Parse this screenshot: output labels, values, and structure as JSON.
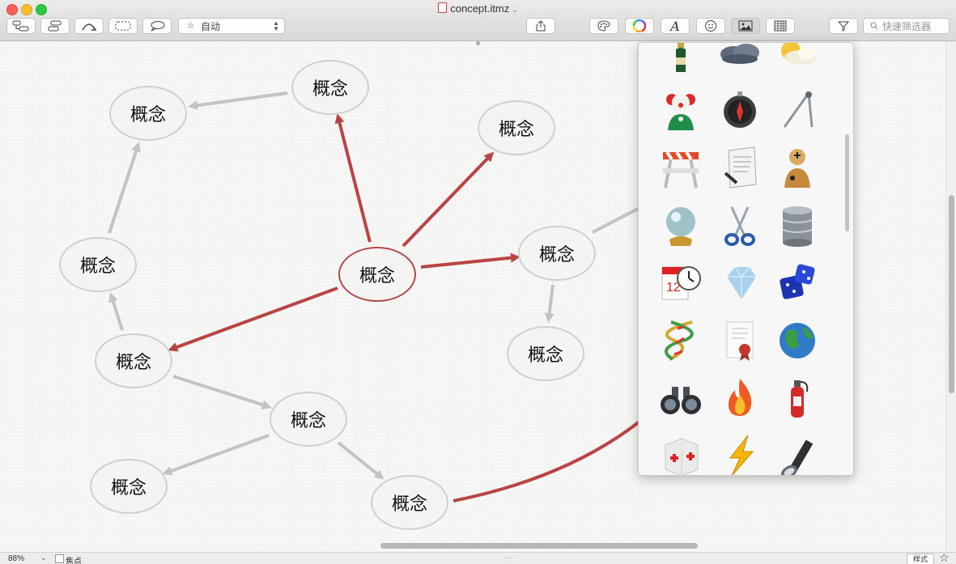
{
  "window": {
    "title": "concept.itmz",
    "title_menu_icon": "chevron-down-icon"
  },
  "toolbar": {
    "buttons": [
      {
        "name": "add-topic-button",
        "icon": "add-topic-icon"
      },
      {
        "name": "add-subtopic-button",
        "icon": "add-subtopic-icon"
      },
      {
        "name": "relationship-button",
        "icon": "relationship-arrow-icon"
      },
      {
        "name": "boundary-button",
        "icon": "boundary-icon"
      },
      {
        "name": "callout-button",
        "icon": "callout-icon"
      }
    ],
    "layout_select": {
      "icon": "star-icon",
      "value": "自动"
    },
    "share_icon": "share-icon",
    "style_buttons": [
      "palette-icon",
      "color-wheel-icon",
      "font-icon",
      "emoji-icon",
      "image-icon",
      "table-icon"
    ],
    "filter_icon": "filter-icon",
    "filter_placeholder": "快速筛选器"
  },
  "map": {
    "root": "概念",
    "nodes": [
      "概念",
      "概念",
      "概念",
      "概念",
      "概念",
      "概念",
      "概念",
      "概念",
      "概念",
      "概念",
      "概念",
      "概念"
    ],
    "colors": {
      "relationship": "#b84444",
      "link": "#c3c3c3",
      "node_border": "#cfcfcf"
    }
  },
  "image_panel": {
    "icons": [
      "champagne-icon",
      "cloud-icon",
      "sun-cloud-icon",
      "clown-icon",
      "compass-icon",
      "drawing-compass-icon",
      "barrier-icon",
      "contract-icon",
      "crash-dummy-icon",
      "crystal-ball-icon",
      "scissors-icon",
      "database-icon",
      "calendar-clock-icon",
      "diamond-icon",
      "dice-icon",
      "dna-icon",
      "certificate-icon",
      "globe-icon",
      "binoculars-icon",
      "fire-icon",
      "fire-extinguisher-icon",
      "first-aid-icon",
      "lightning-icon",
      "flashlight-icon"
    ]
  },
  "statusbar": {
    "zoom": "88%",
    "focus_label": "焦点",
    "style_label": "样式",
    "favorite_icon": "star-icon"
  }
}
